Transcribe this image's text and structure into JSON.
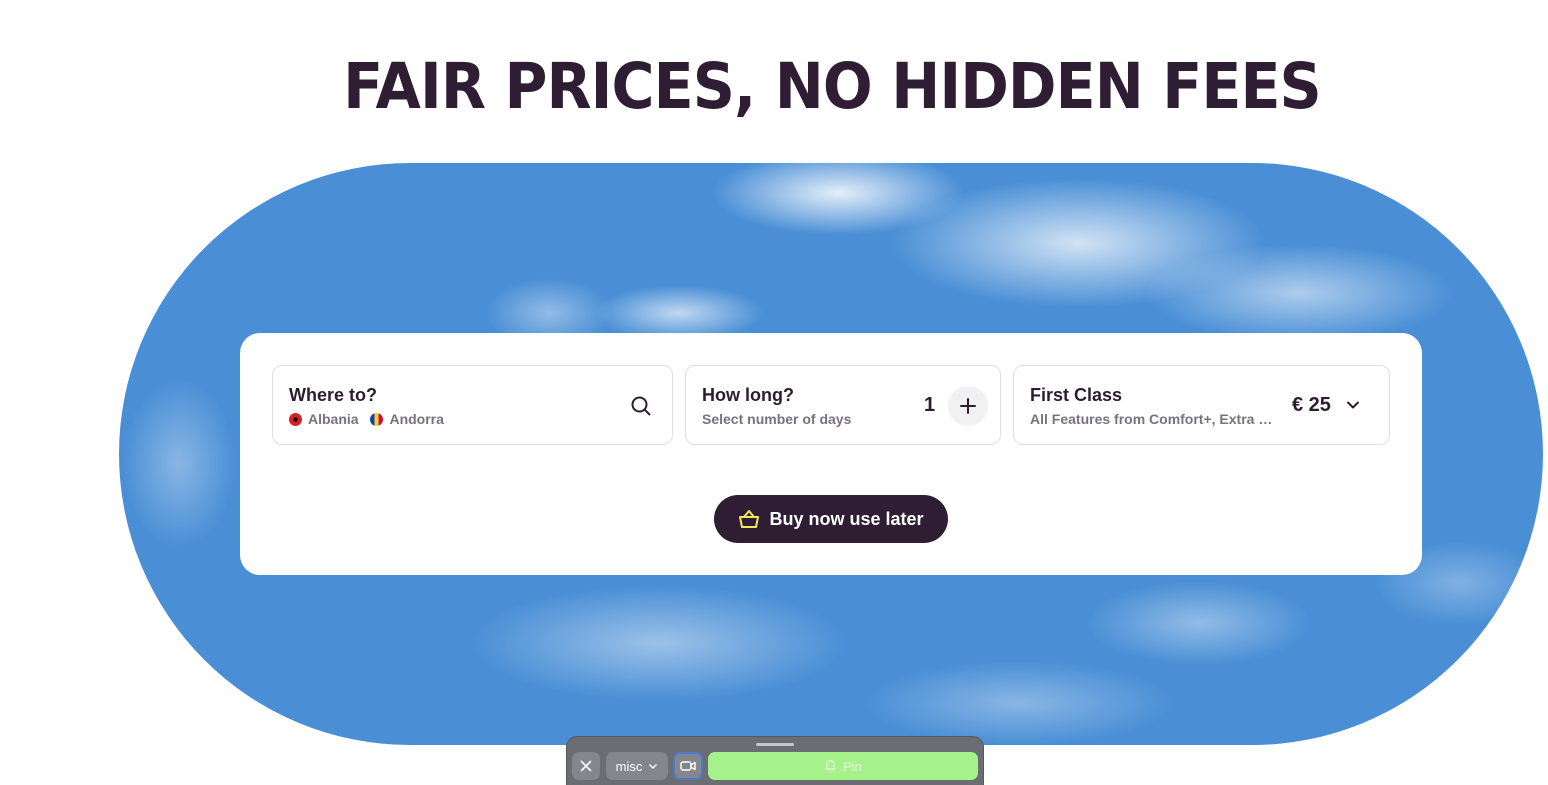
{
  "headline": "FAIR PRICES, NO HIDDEN FEES",
  "destination": {
    "title": "Where to?",
    "countries": [
      "Albania",
      "Andorra"
    ]
  },
  "duration": {
    "title": "How long?",
    "subtitle": "Select number of days",
    "value": "1"
  },
  "plan": {
    "title": "First Class",
    "subtitle": "All Features from Comfort+, Extra High-Speed Data",
    "price": "€ 25"
  },
  "buy_button": {
    "label": "Buy now use later"
  },
  "dock": {
    "select_label": "misc",
    "pin_label": "Pin"
  },
  "colors": {
    "brand_dark": "#2f1d33",
    "sky": "#4a8fd6",
    "basket_accent": "#f1e85a",
    "pin_green": "#a6f28a"
  },
  "icons": [
    "search-icon",
    "plus-icon",
    "chevron-down-icon",
    "basket-icon",
    "close-icon",
    "video-icon",
    "bell-icon"
  ]
}
